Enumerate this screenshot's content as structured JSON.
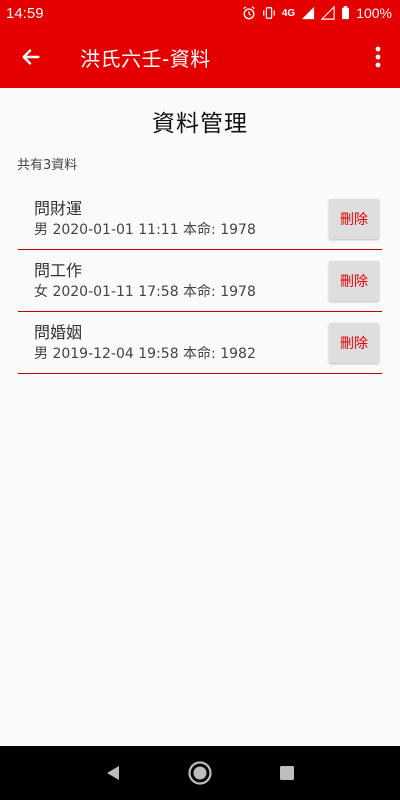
{
  "status_bar": {
    "time": "14:59",
    "network": "4G",
    "battery": "100%",
    "icons": [
      "alarm-icon",
      "vibrate-icon",
      "signal-icon",
      "battery-icon"
    ]
  },
  "app_bar": {
    "title": "洪氏六壬-資料",
    "back_icon": "arrow-left-icon",
    "menu_icon": "more-vert-icon"
  },
  "page": {
    "title": "資料管理",
    "count": "共有3資料"
  },
  "records": [
    {
      "name": "問財運",
      "info": "男 2020-01-01  11:11  本命: 1978",
      "delete_label": "刪除"
    },
    {
      "name": "問工作",
      "info": "女 2020-01-11  17:58  本命: 1978",
      "delete_label": "刪除"
    },
    {
      "name": "問婚姻",
      "info": "男 2019-12-04  19:58  本命: 1982",
      "delete_label": "刪除"
    }
  ],
  "nav_bar": {
    "icons": [
      "nav-back-icon",
      "nav-home-icon",
      "nav-recents-icon"
    ]
  },
  "colors": {
    "primary": "#e50000",
    "divider": "#c00000",
    "delete_text": "#e50000",
    "delete_bg": "#dedede"
  }
}
